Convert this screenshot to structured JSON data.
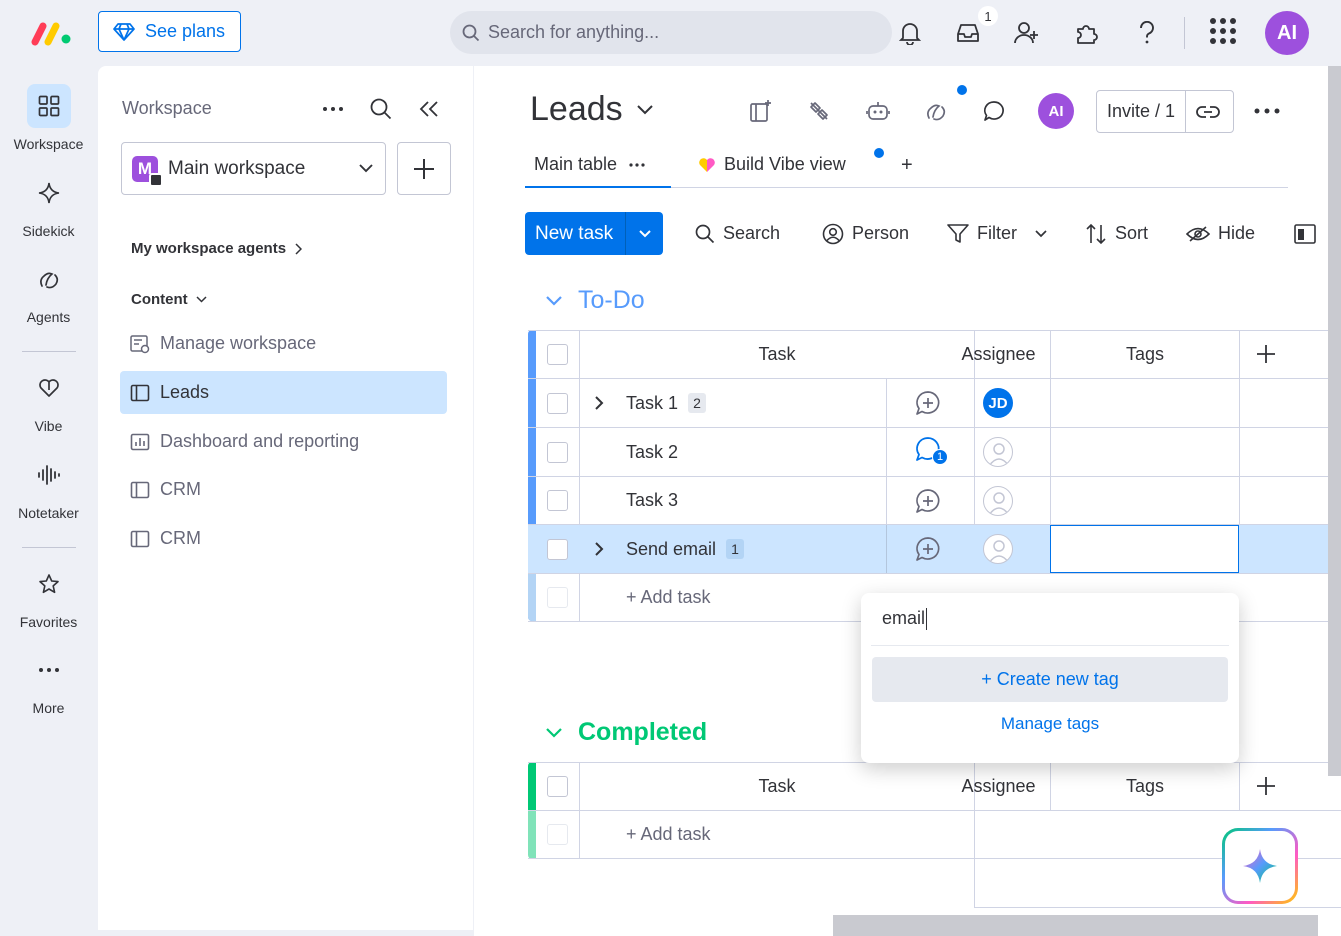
{
  "topbar": {
    "see_plans": "See plans",
    "search_placeholder": "Search for anything...",
    "inbox_count": "1",
    "user_initials": "AI"
  },
  "rail": {
    "items": [
      {
        "label": "Workspace",
        "icon": "grid-icon"
      },
      {
        "label": "Sidekick",
        "icon": "sparkle-icon"
      },
      {
        "label": "Agents",
        "icon": "agents-icon"
      },
      {
        "label": "Vibe",
        "icon": "heart-icon"
      },
      {
        "label": "Notetaker",
        "icon": "waveform-icon"
      },
      {
        "label": "Favorites",
        "icon": "star-icon"
      },
      {
        "label": "More",
        "icon": "more-dots-icon"
      }
    ]
  },
  "sidebar": {
    "title": "Workspace",
    "workspace_logo": "M",
    "workspace_name": "Main workspace",
    "agents_section": "My workspace agents",
    "content_section": "Content",
    "items": [
      {
        "label": "Manage workspace",
        "icon": "manage-icon"
      },
      {
        "label": "Leads",
        "icon": "board-icon"
      },
      {
        "label": "Dashboard and reporting",
        "icon": "dashboard-icon"
      },
      {
        "label": "CRM",
        "icon": "board-icon"
      },
      {
        "label": "CRM",
        "icon": "board-icon"
      }
    ]
  },
  "board": {
    "title": "Leads",
    "user_initials": "AI",
    "invite_label": "Invite / 1",
    "tabs": [
      {
        "label": "Main table"
      },
      {
        "label": "Build Vibe view"
      }
    ],
    "add_tab": "+",
    "toolbar": {
      "new_task": "New task",
      "search": "Search",
      "person": "Person",
      "filter": "Filter",
      "sort": "Sort",
      "hide": "Hide"
    }
  },
  "groups": {
    "todo": {
      "title": "To-Do",
      "color": "#579bfc",
      "columns": {
        "task": "Task",
        "assignee": "Assignee",
        "tags": "Tags"
      },
      "rows": [
        {
          "name": "Task 1",
          "subitems": "2",
          "assignee": "JD"
        },
        {
          "name": "Task 2",
          "updates": "1"
        },
        {
          "name": "Task 3"
        },
        {
          "name": "Send email",
          "subitems": "1"
        }
      ],
      "add_task": "+ Add task"
    },
    "completed": {
      "title": "Completed",
      "color": "#00c875",
      "columns": {
        "task": "Task",
        "assignee": "Assignee",
        "tags": "Tags"
      },
      "add_task": "+ Add task"
    }
  },
  "tag_popup": {
    "input_value": "email",
    "create_label": "+ Create new tag",
    "manage_label": "Manage tags"
  }
}
